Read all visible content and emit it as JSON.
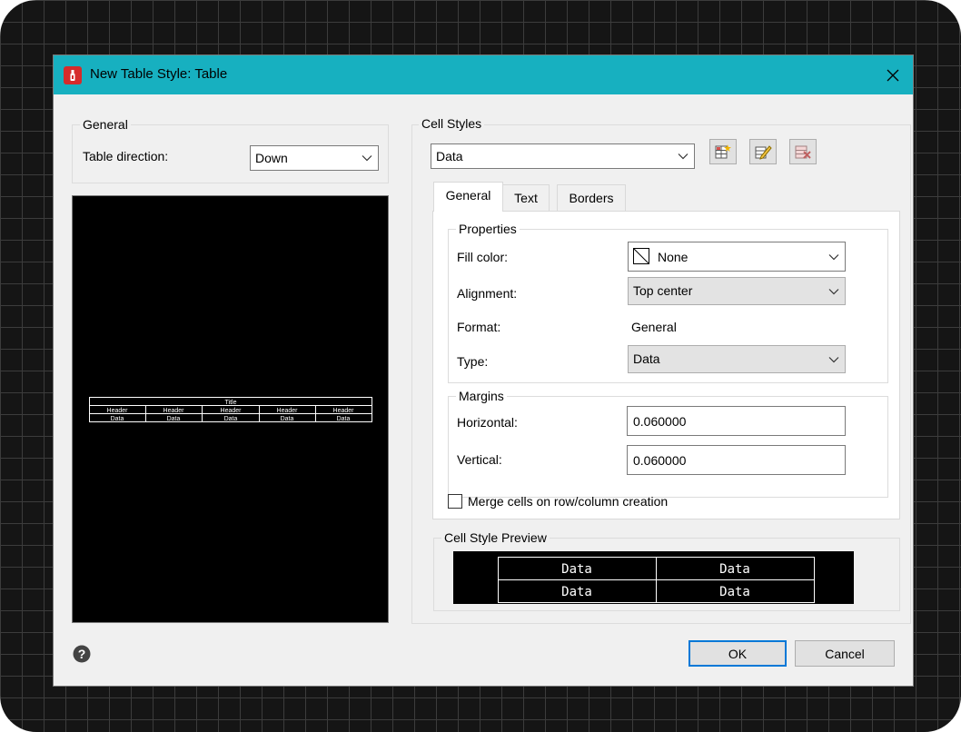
{
  "window": {
    "title": "New Table Style: Table",
    "close_icon": "close-icon",
    "app_icon": "autocad-app-icon"
  },
  "general": {
    "group_label": "General",
    "table_direction_label": "Table direction:",
    "table_direction_value": "Down"
  },
  "table_preview": {
    "title": "Title",
    "header_cells": [
      "Header",
      "Header",
      "Header",
      "Header",
      "Header"
    ],
    "data_cells": [
      "Data",
      "Data",
      "Data",
      "Data",
      "Data"
    ]
  },
  "cell_styles": {
    "group_label": "Cell Styles",
    "selected_style": "Data",
    "toolbar_icons": [
      "create-cell-style-icon",
      "manage-cell-styles-icon",
      "disabled-cell-style-icon"
    ]
  },
  "tabs": [
    {
      "label": "General",
      "active": true
    },
    {
      "label": "Text",
      "active": false
    },
    {
      "label": "Borders",
      "active": false
    }
  ],
  "properties": {
    "group_label": "Properties",
    "fill_color_label": "Fill color:",
    "fill_color_value": "None",
    "alignment_label": "Alignment:",
    "alignment_value": "Top center",
    "format_label": "Format:",
    "format_value": "General",
    "type_label": "Type:",
    "type_value": "Data"
  },
  "margins": {
    "group_label": "Margins",
    "horizontal_label": "Horizontal:",
    "horizontal_value": "0.060000",
    "vertical_label": "Vertical:",
    "vertical_value": "0.060000"
  },
  "merge_cells": {
    "label": "Merge cells on row/column creation",
    "checked": false
  },
  "cell_style_preview": {
    "group_label": "Cell Style Preview",
    "cells": [
      "Data",
      "Data",
      "Data",
      "Data"
    ]
  },
  "footer": {
    "help_icon": "help-icon",
    "ok_label": "OK",
    "cancel_label": "Cancel"
  },
  "colors": {
    "titlebar": "#17b0c0",
    "dialog_bg": "#f0f0f0",
    "app_icon": "#d62b2b",
    "preview_bg": "#000000",
    "default_button_border": "#0078d7"
  }
}
